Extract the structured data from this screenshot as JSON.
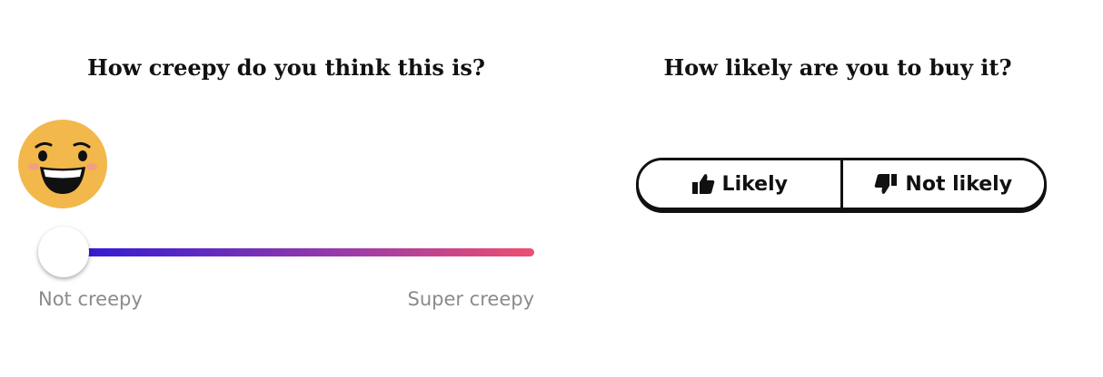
{
  "creepiness": {
    "question": "How creepy do you think this is?",
    "emoji_icon": "grinning-face-icon",
    "slider_value": 0,
    "min_label": "Not creepy",
    "max_label": "Super creepy",
    "gradient_colors": [
      "#2a1ad6",
      "#ee4f6f"
    ]
  },
  "purchase": {
    "question": "How likely are you to buy it?",
    "likely_label": "Likely",
    "likely_icon": "thumbs-up-icon",
    "not_likely_label": "Not likely",
    "not_likely_icon": "thumbs-down-icon"
  }
}
